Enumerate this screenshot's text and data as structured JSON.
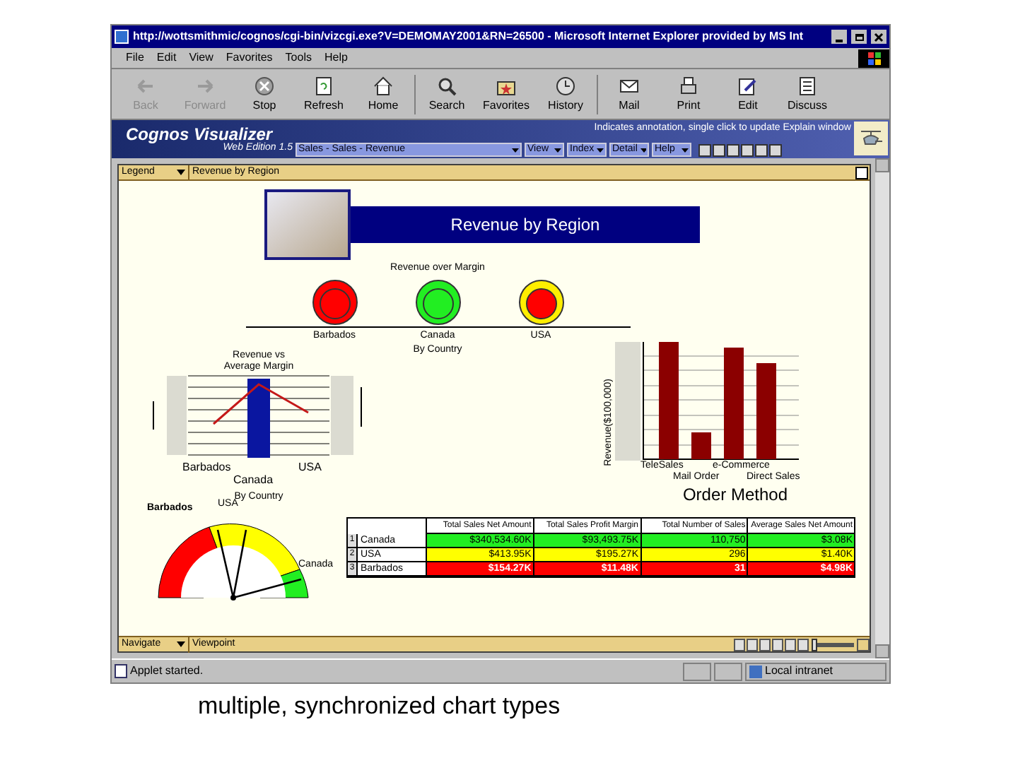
{
  "window": {
    "title": "http://wottsmithmic/cognos/cgi-bin/vizcgi.exe?V=DEMOMAY2001&RN=26500 - Microsoft Internet Explorer provided by MS Int"
  },
  "menu": [
    "File",
    "Edit",
    "View",
    "Favorites",
    "Tools",
    "Help"
  ],
  "toolbar": [
    {
      "label": "Back",
      "disabled": true
    },
    {
      "label": "Forward",
      "disabled": true
    },
    {
      "label": "Stop",
      "disabled": false
    },
    {
      "label": "Refresh",
      "disabled": false
    },
    {
      "label": "Home",
      "disabled": false
    },
    {
      "label": "Search",
      "disabled": false
    },
    {
      "label": "Favorites",
      "disabled": false
    },
    {
      "label": "History",
      "disabled": false
    },
    {
      "label": "Mail",
      "disabled": false
    },
    {
      "label": "Print",
      "disabled": false
    },
    {
      "label": "Edit",
      "disabled": false
    },
    {
      "label": "Discuss",
      "disabled": false
    }
  ],
  "app_header": {
    "title": "Cognos Visualizer",
    "subtitle": "Web Edition 1.5",
    "hint": "Indicates annotation, single click to update Explain window",
    "dropdowns": [
      "Sales - Sales - Revenue",
      "View",
      "Index",
      "Detail",
      "Help"
    ]
  },
  "legend_bar": {
    "legend": "Legend",
    "title": "Revenue by Region"
  },
  "banner": {
    "title": "Revenue by Region"
  },
  "indicators": {
    "title": "Revenue over Margin",
    "axis": "By Country",
    "items": [
      {
        "label": "Barbados",
        "color": "#ff0000",
        "core": {
          "color": "#ff0000"
        }
      },
      {
        "label": "Canada",
        "color": "#22ee22",
        "core": {
          "color": "#22ee22"
        }
      },
      {
        "label": "USA",
        "color": "#ffee00",
        "core": {
          "color": "#ff0000"
        }
      }
    ]
  },
  "combo_chart": {
    "title": "Revenue vs Average Margin",
    "categories": [
      "Barbados",
      "Canada",
      "USA"
    ],
    "axis": "By Country"
  },
  "bar_chart": {
    "ylabel": "Revenue($100,000)",
    "categories": [
      "TeleSales",
      "Mail Order",
      "e-Commerce",
      "Direct Sales"
    ],
    "title": "Order Method"
  },
  "gauge": {
    "labels": [
      "Barbados",
      "USA",
      "Canada"
    ]
  },
  "table": {
    "columns": [
      "Total Sales Net Amount",
      "Total Sales Profit Margin",
      "Total Number of Sales",
      "Average Sales Net Amount"
    ],
    "rows": [
      {
        "index": "1",
        "name": "Canada",
        "color": "#22ee22",
        "cells": [
          "$340,534.60K",
          "$93,493.75K",
          "110,750",
          "$3.08K"
        ]
      },
      {
        "index": "2",
        "name": "USA",
        "color": "#ffff00",
        "cells": [
          "$413.95K",
          "$195.27K",
          "296",
          "$1.40K"
        ]
      },
      {
        "index": "3",
        "name": "Barbados",
        "color": "#ff0000",
        "cells": [
          "$154.27K",
          "$11.48K",
          "31",
          "$4.98K"
        ]
      }
    ]
  },
  "navigate_bar": {
    "navigate": "Navigate",
    "viewpoint": "Viewpoint",
    "slider": {
      "level": 0
    }
  },
  "status_bar": {
    "status": "Applet started.",
    "zone": "Local intranet"
  },
  "caption": "multiple, synchronized chart types"
}
